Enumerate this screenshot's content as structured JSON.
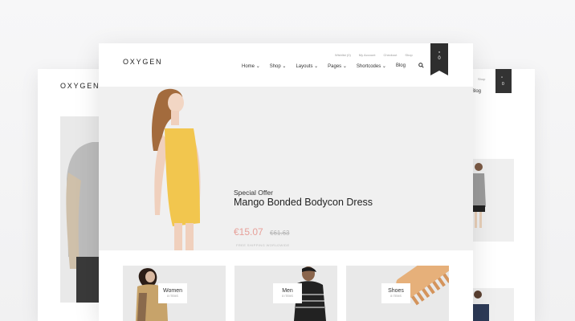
{
  "brand": {
    "logo": "OXYGEN"
  },
  "main": {
    "top_links": [
      "Wishlist (0)",
      "My Account",
      "Checkout",
      "Shop"
    ],
    "nav": [
      "Home",
      "Shop",
      "Layouts",
      "Pages",
      "Shortcodes",
      "Blog"
    ],
    "cart_count": "0",
    "hero": {
      "eyebrow": "Special Offer",
      "title": "Mango Bonded Bodycon Dress",
      "price": "€15.07",
      "old_price": "€61.63",
      "note": "FREE SHIPPING WORLDWIDE"
    },
    "categories": [
      {
        "name": "Women",
        "items": "8 ITEMS"
      },
      {
        "name": "Men",
        "items": "8 ITEMS"
      },
      {
        "name": "Shoes",
        "items": "8 ITEMS"
      }
    ]
  },
  "right_card": {
    "nav_label": "Blog",
    "top_link": "Shop",
    "cart_count": "0"
  },
  "colors": {
    "price": "#e7a19a",
    "dark": "#2e2e2e"
  }
}
